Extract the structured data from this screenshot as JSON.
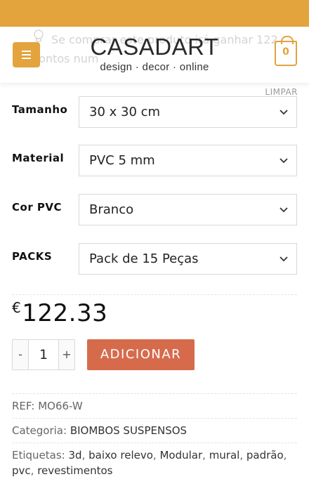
{
  "header": {
    "notice": "Se comprar este produto irá ganhar 122 pontos num",
    "brand": "CASADART",
    "tagline": "design · decor · online",
    "cart_count": "0",
    "accent": "#e3a33d"
  },
  "options": {
    "clear_label": "LIMPAR",
    "rows": [
      {
        "label": "Tamanho",
        "value": "30 x 30 cm"
      },
      {
        "label": "Material",
        "value": "PVC 5 mm"
      },
      {
        "label": "Cor PVC",
        "value": "Branco"
      },
      {
        "label": "PACKS",
        "value": "Pack de 15 Peças"
      }
    ]
  },
  "purchase": {
    "currency": "€",
    "price": "122.33",
    "qty_minus": "-",
    "qty_value": "1",
    "qty_plus": "+",
    "add_label": "ADICIONAR",
    "add_color": "#d66b4c"
  },
  "meta": {
    "ref_label": "REF:",
    "ref_value": "MO66-W",
    "category_label": "Categoria:",
    "category_value": "BIOMBOS SUSPENSOS",
    "tags_label": "Etiquetas:",
    "tags": [
      "3d",
      "baixo relevo",
      "Modular",
      "mural",
      "padrão",
      "pvc",
      "revestimentos"
    ]
  }
}
